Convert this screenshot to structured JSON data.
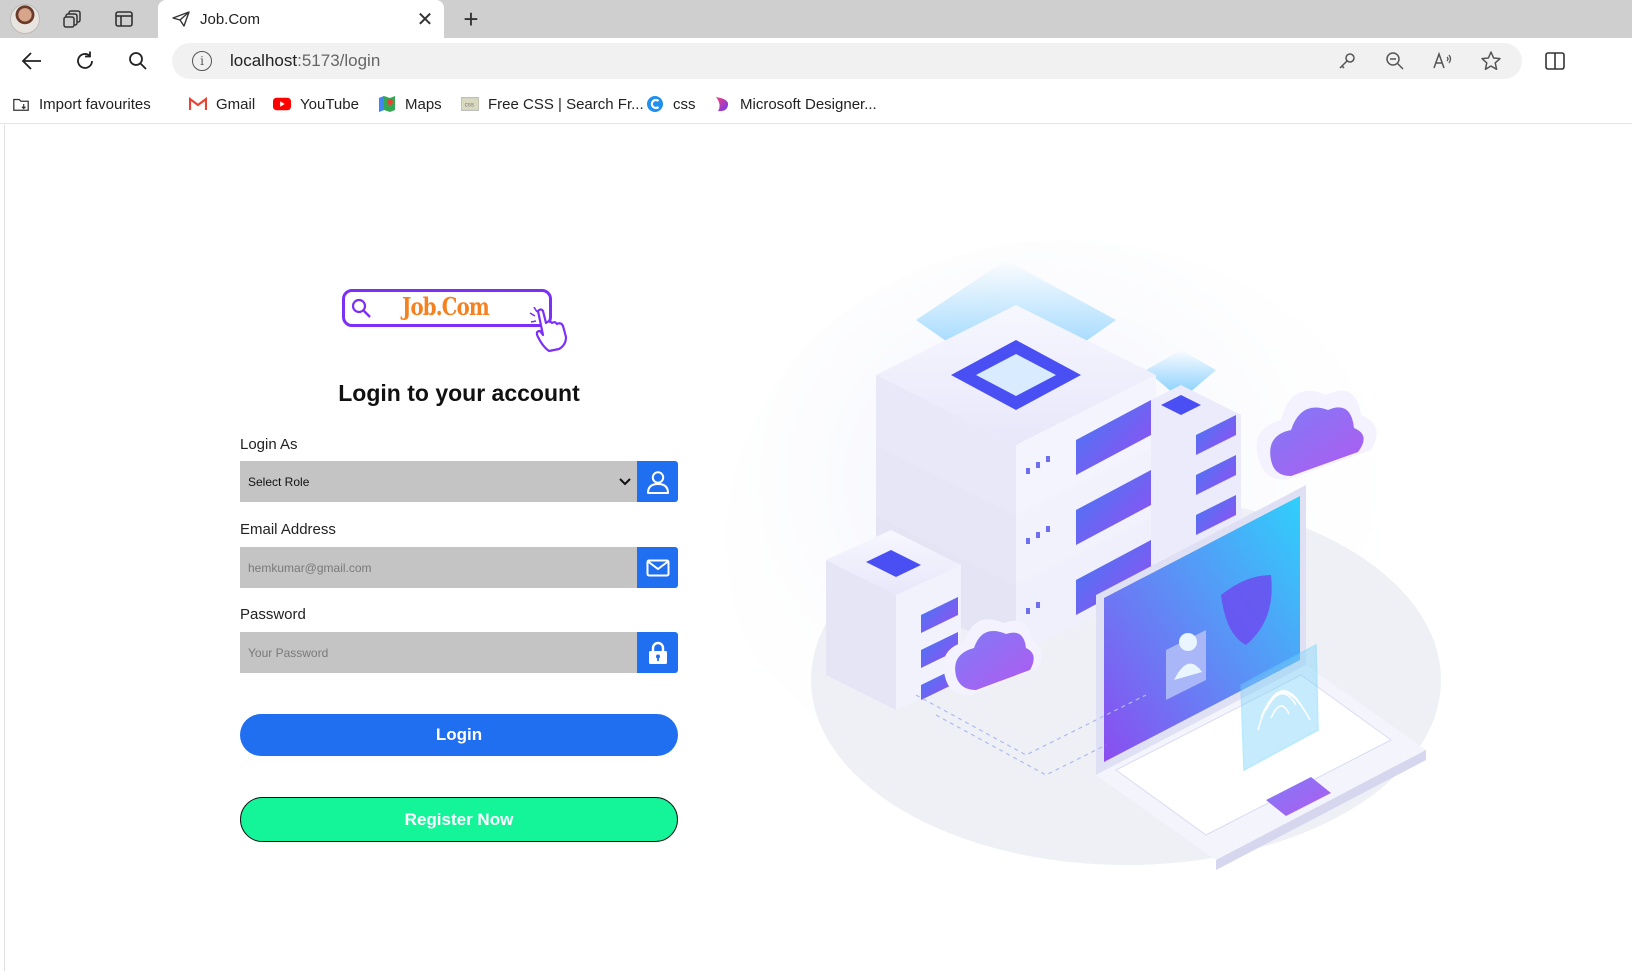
{
  "browser": {
    "tab": {
      "title": "Job.Com",
      "close": "✕"
    },
    "new_tab": "+",
    "address": {
      "host": "localhost",
      "path": ":5173/login"
    },
    "bookmarks": [
      {
        "label": "Import favourites",
        "icon": "import-icon"
      },
      {
        "label": "Gmail",
        "icon": "gmail-icon"
      },
      {
        "label": "YouTube",
        "icon": "youtube-icon"
      },
      {
        "label": "Maps",
        "icon": "maps-icon"
      },
      {
        "label": "Free CSS | Search Fr...",
        "icon": "css-site-icon"
      },
      {
        "label": "css",
        "icon": "css-c-icon"
      },
      {
        "label": "Microsoft Designer...",
        "icon": "designer-icon"
      }
    ]
  },
  "login": {
    "logo_text": "Job.Com",
    "heading": "Login to your account",
    "role_label": "Login As",
    "role_value": "Select Role",
    "email_label": "Email Address",
    "email_placeholder": "hemkumar@gmail.com",
    "password_label": "Password",
    "password_placeholder": "Your Password",
    "login_button": "Login",
    "register_button": "Register Now"
  },
  "colors": {
    "primary": "#1f6ff0",
    "register": "#14f59a",
    "logo_border": "#7b2ff7",
    "logo_text": "#f58220",
    "field_bg": "#c4c4c4"
  }
}
